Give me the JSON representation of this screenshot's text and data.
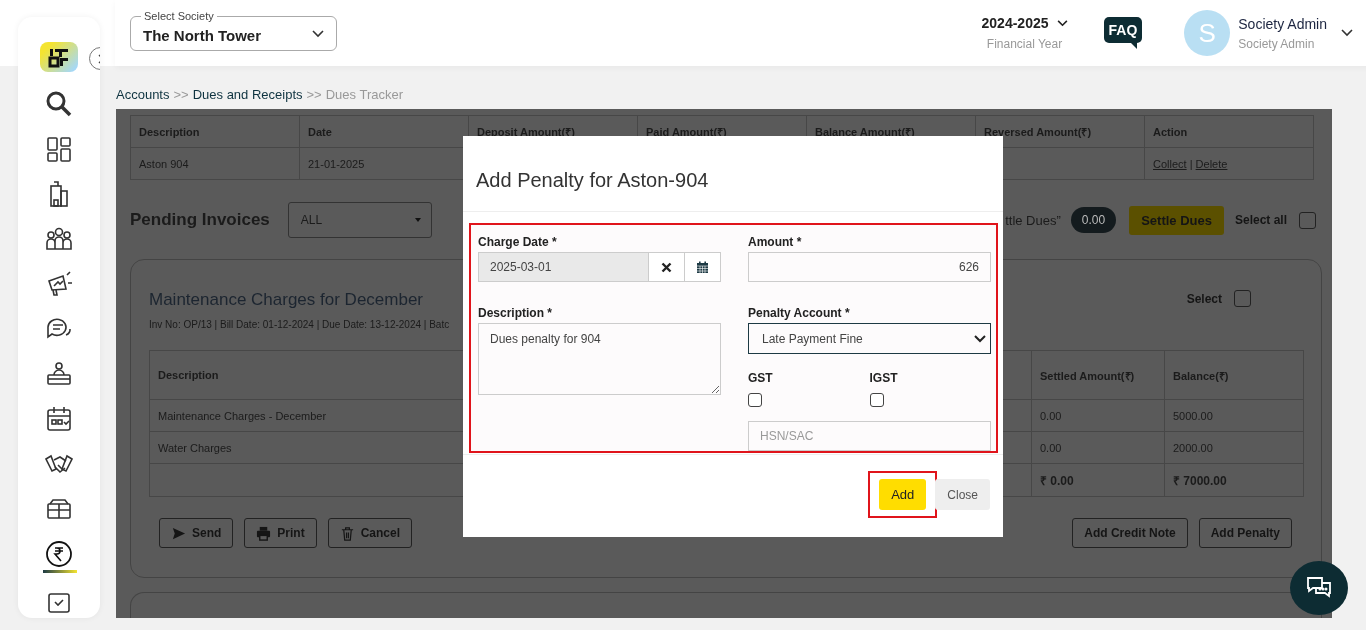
{
  "header": {
    "society_select": {
      "label": "Select Society",
      "value": "The North Tower"
    },
    "financial_year": {
      "value": "2024-2025",
      "label": "Financial Year"
    },
    "faq": "FAQ",
    "user": {
      "initial": "S",
      "name": "Society Admin",
      "role": "Society Admin"
    }
  },
  "sidebar": {
    "items": [
      {
        "selected": false
      },
      {
        "selected": false
      },
      {
        "selected": false
      },
      {
        "selected": false
      },
      {
        "selected": false
      },
      {
        "selected": false
      },
      {
        "selected": false
      },
      {
        "selected": false
      },
      {
        "selected": false
      },
      {
        "selected": false
      },
      {
        "selected": true
      },
      {
        "selected": false
      }
    ]
  },
  "breadcrumb": [
    {
      "label": "Accounts",
      "current": false
    },
    {
      "separator": ">>",
      "label": "Dues and Receipts",
      "current": false
    },
    {
      "separator": ">>",
      "label": "Dues Tracker",
      "current": true
    }
  ],
  "deposits_table": {
    "columns": [
      "Description",
      "Date",
      "Deposit Amount(₹)",
      "Paid Amount(₹)",
      "Balance Amount(₹)",
      "Reversed Amount(₹)",
      "Action"
    ],
    "rows": [
      {
        "description": "Aston 904",
        "date": "21-01-2025",
        "actions": [
          "Collect",
          "Delete"
        ],
        "actions_separator": "|"
      }
    ]
  },
  "pending": {
    "title": "Pending Invoices",
    "filter": "ALL",
    "hint": "ttle Dues”",
    "total": "0.00",
    "settle_button": "Settle Dues",
    "select_all": {
      "label": "Select all",
      "checked": false
    }
  },
  "invoice": {
    "title": "Maintenance Charges for December",
    "meta": "Inv No: OP/13 | Bill Date: 01-12-2024 | Due Date: 13-12-2024 | Batc",
    "select": {
      "label": "Select",
      "checked": false
    },
    "columns": [
      "Description",
      "Settled Amount(₹)",
      "Balance(₹)"
    ],
    "rows": [
      {
        "description": "Maintenance Charges - December",
        "settled": "0.00",
        "balance": "5000.00"
      },
      {
        "description": "Water Charges",
        "settled": "0.00",
        "balance": "2000.00"
      }
    ],
    "totals": {
      "settled": "₹ 0.00",
      "balance": "₹ 7000.00"
    },
    "actions_left": [
      "Send",
      "Print",
      "Cancel"
    ],
    "actions_right": [
      "Add Credit Note",
      "Add Penalty"
    ]
  },
  "modal": {
    "title": "Add Penalty for Aston-904",
    "form_highlighted": true,
    "charge_date": {
      "label": "Charge Date *",
      "value": "2025-03-01"
    },
    "amount": {
      "label": "Amount *",
      "value": "626"
    },
    "description": {
      "label": "Description *",
      "value": "Dues penalty for 904"
    },
    "penalty_account": {
      "label": "Penalty Account *",
      "value": "Late Payment Fine"
    },
    "gst": {
      "label": "GST",
      "checked": false
    },
    "igst": {
      "label": "IGST",
      "checked": false
    },
    "hsn": {
      "placeholder": "HSN/SAC"
    },
    "buttons": [
      {
        "label": "Add",
        "kind": "primary",
        "highlighted": true
      },
      {
        "label": "Close",
        "kind": "secondary",
        "highlighted": false
      }
    ]
  }
}
